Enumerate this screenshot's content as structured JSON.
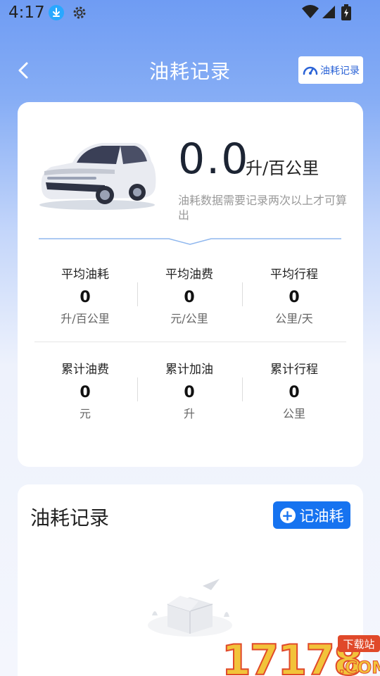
{
  "status_bar": {
    "time": "4:17"
  },
  "header": {
    "title": "油耗记录",
    "records_button_label": "油耗记录"
  },
  "summary": {
    "consumption_value": "0.0",
    "consumption_unit": "升/百公里",
    "note": "油耗数据需要记录两次以上才可算出"
  },
  "metrics_row1": [
    {
      "label": "平均油耗",
      "value": "0",
      "unit": "升/百公里"
    },
    {
      "label": "平均油费",
      "value": "0",
      "unit": "元/公里"
    },
    {
      "label": "平均行程",
      "value": "0",
      "unit": "公里/天"
    }
  ],
  "metrics_row2": [
    {
      "label": "累计油费",
      "value": "0",
      "unit": "元"
    },
    {
      "label": "累计加油",
      "value": "0",
      "unit": "升"
    },
    {
      "label": "累计行程",
      "value": "0",
      "unit": "公里"
    }
  ],
  "records": {
    "title": "油耗记录",
    "add_button_label": "记油耗",
    "add_icon": "+"
  },
  "watermark": {
    "number": "17178",
    "tag": "下载站",
    "domain": ".COM"
  },
  "colors": {
    "accent": "#1673f0",
    "header_bg": "#6f9cf3"
  }
}
